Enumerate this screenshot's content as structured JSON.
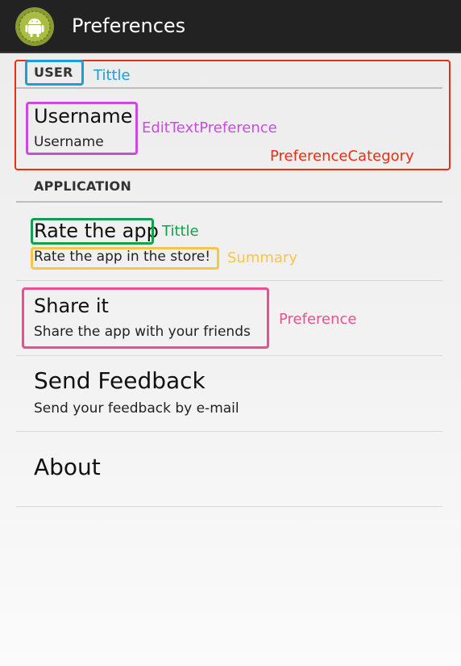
{
  "action_bar": {
    "title": "Preferences",
    "icon": "android-robot-icon"
  },
  "categories": {
    "user": {
      "title": "USER",
      "items": [
        {
          "title": "Username",
          "summary": "Username"
        }
      ]
    },
    "application": {
      "title": "APPLICATION",
      "items": [
        {
          "title": "Rate the app",
          "summary": "Rate the app in the store!"
        },
        {
          "title": "Share it",
          "summary": "Share the app with your friends"
        },
        {
          "title": "Send Feedback",
          "summary": "Send your feedback by e-mail"
        },
        {
          "title": "About",
          "summary": ""
        }
      ]
    }
  },
  "annotations": {
    "category_title": {
      "label": "Tittle",
      "color": "#1a9fd6"
    },
    "edit_text_preference": {
      "label": "EditTextPreference",
      "color": "#c54fd9"
    },
    "preference_category": {
      "label": "PreferenceCategory",
      "color": "#ee2d12"
    },
    "item_title": {
      "label": "Tittle",
      "color": "#14a04a"
    },
    "summary": {
      "label": "Summary",
      "color": "#f5c64a"
    },
    "preference": {
      "label": "Preference",
      "color": "#ea4f8f"
    }
  }
}
